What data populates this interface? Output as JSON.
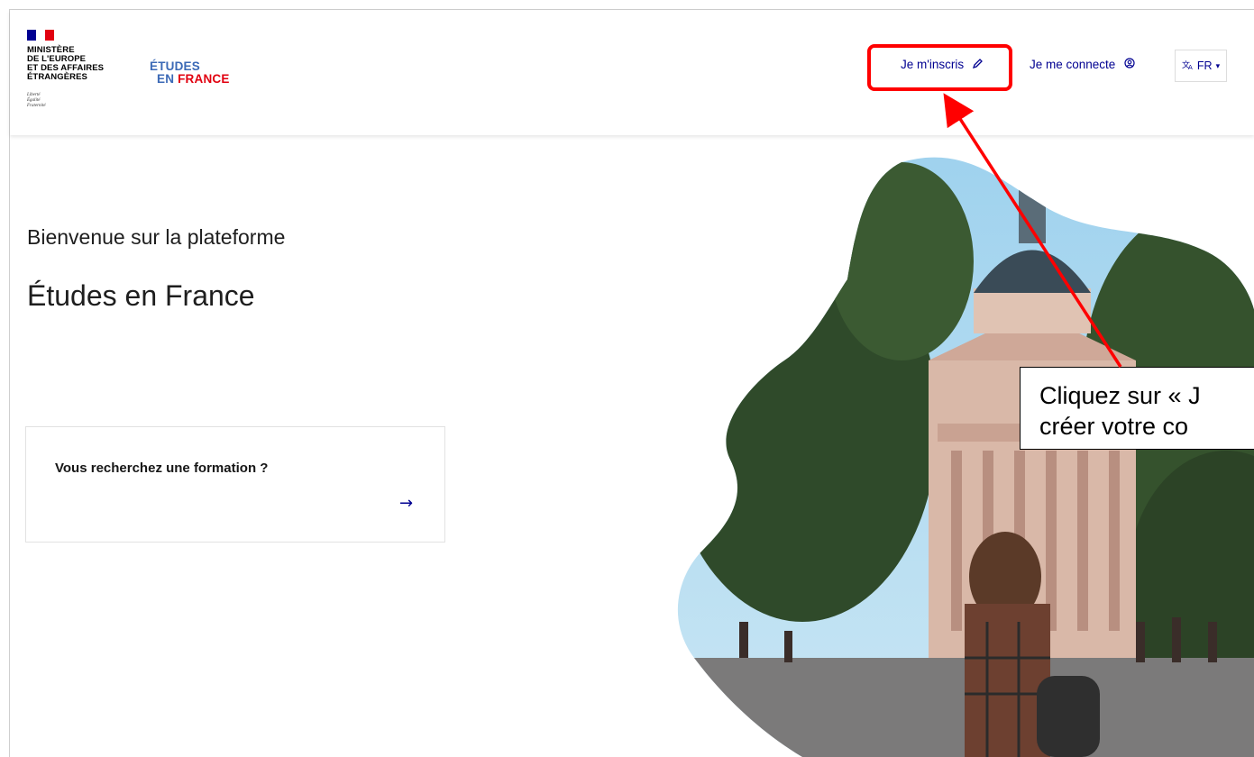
{
  "header": {
    "ministry_lines": [
      "MINISTÈRE",
      "DE L'EUROPE",
      "ET DES AFFAIRES",
      "ÉTRANGÈRES"
    ],
    "devise_lines": [
      "Liberté",
      "Égalité",
      "Fraternité"
    ],
    "logo_line1": "ÉTUDES",
    "logo_line2_en": "EN",
    "logo_line2_france": "FRANCE",
    "nav": {
      "signup_label": "Je m'inscris",
      "signup_icon": "pencil-icon",
      "login_label": "Je me connecte",
      "login_icon": "user-circle-icon",
      "language_icon": "translate-icon",
      "language_label": "FR",
      "language_caret": "▾"
    }
  },
  "main": {
    "welcome": "Bienvenue sur la plateforme",
    "title": "Études en France",
    "card": {
      "title": "Vous recherchez une formation ?",
      "arrow": "→"
    }
  },
  "annotation": {
    "callout_line1": "Cliquez sur « J",
    "callout_line2": "créer votre co",
    "highlight_color": "#ff0000"
  },
  "colors": {
    "primary": "#000091",
    "flag_blue": "#000091",
    "flag_red": "#e1000f",
    "logo_blue": "#3b69b6"
  }
}
